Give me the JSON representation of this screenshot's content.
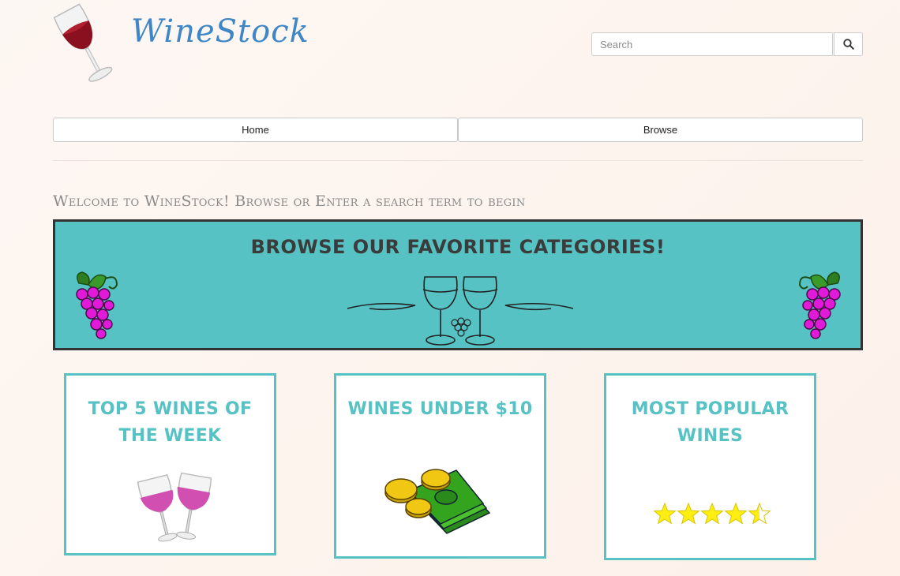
{
  "header": {
    "brand": "WineStock",
    "search": {
      "placeholder": "Search",
      "value": ""
    }
  },
  "icons": {
    "logo": "wine-glass-icon",
    "search": "magnifier-icon",
    "grapes": "grapes-icon",
    "toast": "toasting-glasses-icon",
    "money": "money-icon",
    "stars": "star-icon"
  },
  "nav": {
    "items": [
      {
        "label": "Home"
      },
      {
        "label": "Browse"
      }
    ]
  },
  "welcome": "Welcome to WineStock! Browse or Enter a search term to begin",
  "banner": {
    "title": "Browse our favorite categories!"
  },
  "categories": [
    {
      "title": "Top 5 Wines of the Week"
    },
    {
      "title": "Wines Under $10"
    },
    {
      "title": "Most Popular Wines",
      "rating": 4.5,
      "rating_max": 5
    }
  ],
  "colors": {
    "accent": "#56c2c3",
    "brand": "#3f86c7",
    "banner_border": "#333333"
  }
}
